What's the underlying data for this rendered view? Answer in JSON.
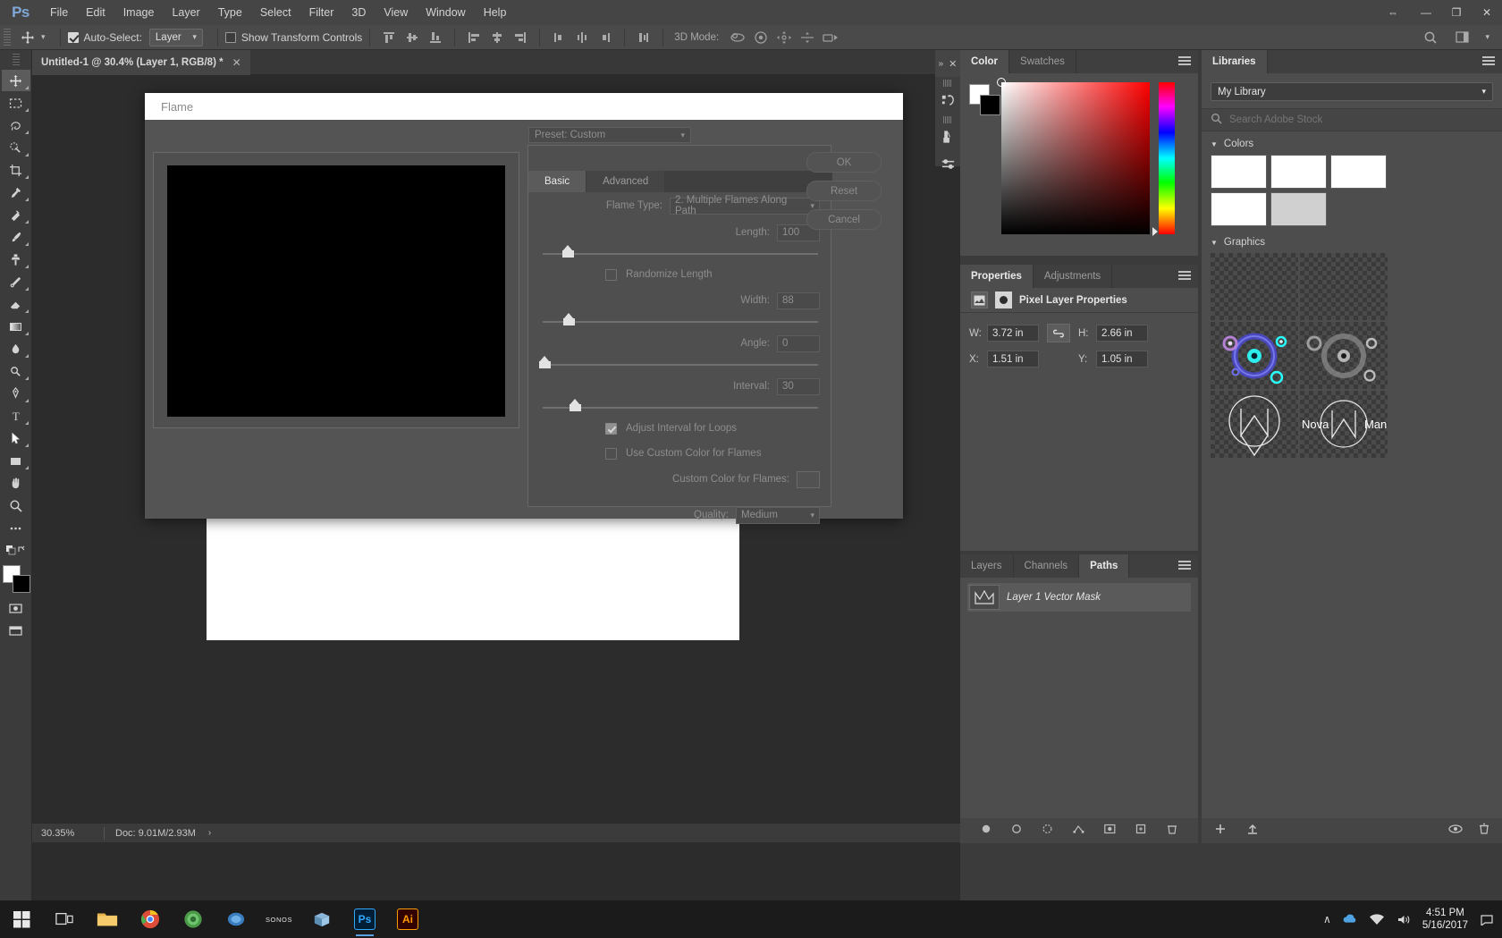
{
  "app": {
    "name": "Ps",
    "logo_text": "Ps"
  },
  "menubar": {
    "items": [
      "File",
      "Edit",
      "Image",
      "Layer",
      "Type",
      "Select",
      "Filter",
      "3D",
      "View",
      "Window",
      "Help"
    ],
    "window_controls": {
      "minimize": "—",
      "maximize": "❐",
      "close": "✕",
      "extra": "⇔"
    }
  },
  "options_bar": {
    "auto_select_label": "Auto-Select:",
    "auto_select_checked": true,
    "layer_select_value": "Layer",
    "show_transform_label": "Show Transform Controls",
    "show_transform_checked": false,
    "mode_3d_label": "3D Mode:",
    "search_icon": "search-icon",
    "workspace_icon": "workspace-icon"
  },
  "document_tab": {
    "title": "Untitled-1 @ 30.4% (Layer 1, RGB/8) *",
    "close": "✕"
  },
  "status_bar": {
    "zoom": "30.35%",
    "doc": "Doc: 9.01M/2.93M",
    "arrow": "›"
  },
  "dialog": {
    "title": "Flame",
    "preset_label": "Preset: Custom",
    "tabs": [
      {
        "label": "Basic",
        "active": true
      },
      {
        "label": "Advanced",
        "active": false
      }
    ],
    "fields": {
      "flame_type_label": "Flame Type:",
      "flame_type_value": "2. Multiple Flames Along Path",
      "length_label": "Length:",
      "length_value": "100",
      "randomize_length_label": "Randomize Length",
      "randomize_length_checked": false,
      "width_label": "Width:",
      "width_value": "88",
      "angle_label": "Angle:",
      "angle_value": "0",
      "interval_label": "Interval:",
      "interval_value": "30",
      "adjust_interval_label": "Adjust Interval for Loops",
      "adjust_interval_checked": true,
      "custom_color_use_label": "Use Custom Color for Flames",
      "custom_color_use_checked": false,
      "custom_color_label": "Custom Color for Flames:",
      "quality_label": "Quality:",
      "quality_value": "Medium"
    },
    "buttons": [
      {
        "label": "OK"
      },
      {
        "label": "Reset"
      },
      {
        "label": "Cancel"
      }
    ]
  },
  "color_panel": {
    "tabs": [
      {
        "label": "Color",
        "active": true
      },
      {
        "label": "Swatches",
        "active": false
      }
    ],
    "foreground": "#ffffff",
    "background": "#000000"
  },
  "properties_panel": {
    "tabs": [
      {
        "label": "Properties",
        "active": true
      },
      {
        "label": "Adjustments",
        "active": false
      }
    ],
    "heading": "Pixel Layer Properties",
    "fields": [
      {
        "label": "W:",
        "value": "3.72 in"
      },
      {
        "label": "H:",
        "value": "2.66 in"
      },
      {
        "label": "X:",
        "value": "1.51 in"
      },
      {
        "label": "Y:",
        "value": "1.05 in"
      }
    ],
    "link_icon": "link-icon"
  },
  "layers_panel": {
    "tabs": [
      {
        "label": "Layers",
        "active": false
      },
      {
        "label": "Channels",
        "active": false
      },
      {
        "label": "Paths",
        "active": true
      }
    ],
    "path_item": "Layer 1 Vector Mask",
    "footer_icons": [
      "fill-path-icon",
      "stroke-path-icon",
      "load-selection-icon",
      "make-work-path-icon",
      "new-path-icon",
      "duplicate-path-icon",
      "delete-path-icon"
    ]
  },
  "libraries_panel": {
    "tabs": [
      {
        "label": "Libraries",
        "active": true
      }
    ],
    "library_value": "My Library",
    "search_placeholder": "Search Adobe Stock",
    "sections": [
      {
        "title": "Colors",
        "swatches": [
          "#ffffff",
          "#ffffff",
          "#ffffff",
          "#ffffff",
          "#d0d0d0"
        ]
      },
      {
        "title": "Graphics",
        "items": [
          "empty-graphic",
          "orbit-graphic",
          "orbit-graphic-2",
          "nova-monogram",
          "nova-man-logo"
        ]
      }
    ],
    "graphic_labels": {
      "nova": "Nova",
      "man": "Man"
    },
    "footer_icons": [
      "add-library-icon",
      "upload-icon",
      "sync-icon",
      "delete-icon"
    ]
  },
  "taskbar": {
    "items": [
      "start-icon",
      "task-view-icon",
      "file-explorer-icon",
      "chrome-icon",
      "firefox-icon",
      "teams-icon",
      "sonos-icon",
      "store-icon",
      "photoshop-icon",
      "illustrator-icon"
    ],
    "sonos_label": "SONOS",
    "ps_label": "Ps",
    "ai_label": "Ai",
    "tray": {
      "up_arrow": "∧",
      "network": "network-icon",
      "volume": "volume-icon",
      "time": "4:51 PM",
      "date": "5/16/2017"
    }
  }
}
